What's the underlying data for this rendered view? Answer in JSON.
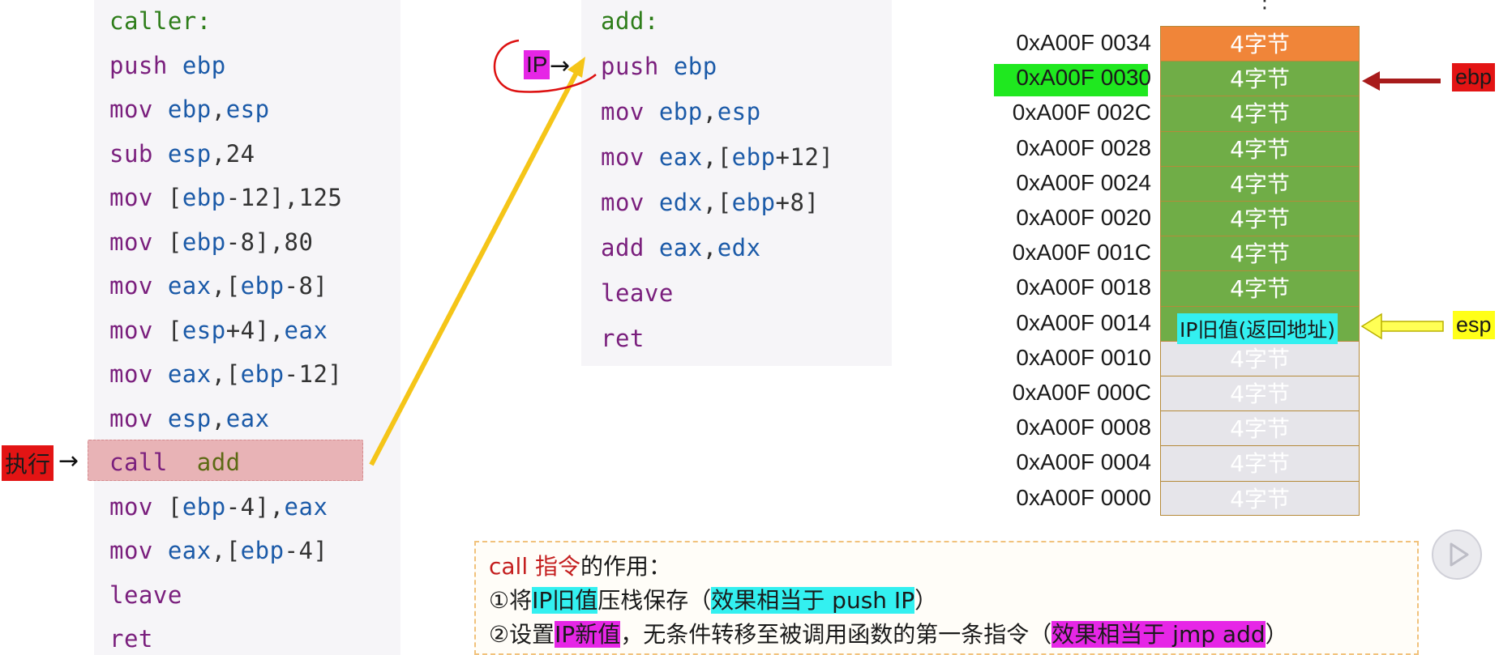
{
  "caller": {
    "lines": [
      [
        {
          "t": "caller:",
          "c": "lbl"
        }
      ],
      [
        {
          "t": "push ",
          "c": "op-purple"
        },
        {
          "t": "ebp",
          "c": "reg"
        }
      ],
      [
        {
          "t": "mov ",
          "c": "op-purple"
        },
        {
          "t": "ebp",
          "c": "reg"
        },
        {
          "t": ",",
          "c": "pun"
        },
        {
          "t": "esp",
          "c": "reg"
        }
      ],
      [
        {
          "t": "sub ",
          "c": "op-purple"
        },
        {
          "t": "esp",
          "c": "reg"
        },
        {
          "t": ",24",
          "c": "num"
        }
      ],
      [
        {
          "t": "mov ",
          "c": "op-purple"
        },
        {
          "t": "[",
          "c": "pun"
        },
        {
          "t": "ebp",
          "c": "reg"
        },
        {
          "t": "-12],125",
          "c": "num"
        }
      ],
      [
        {
          "t": "mov ",
          "c": "op-purple"
        },
        {
          "t": "[",
          "c": "pun"
        },
        {
          "t": "ebp",
          "c": "reg"
        },
        {
          "t": "-8],80",
          "c": "num"
        }
      ],
      [
        {
          "t": "mov ",
          "c": "op-purple"
        },
        {
          "t": "eax",
          "c": "reg"
        },
        {
          "t": ",[",
          "c": "pun"
        },
        {
          "t": "ebp",
          "c": "reg"
        },
        {
          "t": "-8]",
          "c": "num"
        }
      ],
      [
        {
          "t": "mov ",
          "c": "op-purple"
        },
        {
          "t": "[",
          "c": "pun"
        },
        {
          "t": "esp",
          "c": "reg"
        },
        {
          "t": "+4],",
          "c": "num"
        },
        {
          "t": "eax",
          "c": "reg"
        }
      ],
      [
        {
          "t": "mov ",
          "c": "op-purple"
        },
        {
          "t": "eax",
          "c": "reg"
        },
        {
          "t": ",[",
          "c": "pun"
        },
        {
          "t": "ebp",
          "c": "reg"
        },
        {
          "t": "-12]",
          "c": "num"
        }
      ],
      [
        {
          "t": "mov ",
          "c": "op-purple"
        },
        {
          "t": "esp",
          "c": "reg"
        },
        {
          "t": ",",
          "c": "pun"
        },
        {
          "t": "eax",
          "c": "reg"
        }
      ],
      [
        {
          "t": "call  ",
          "c": "op-purple"
        },
        {
          "t": "add",
          "c": "op-green"
        }
      ],
      [
        {
          "t": "mov ",
          "c": "op-purple"
        },
        {
          "t": "[",
          "c": "pun"
        },
        {
          "t": "ebp",
          "c": "reg"
        },
        {
          "t": "-4],",
          "c": "num"
        },
        {
          "t": "eax",
          "c": "reg"
        }
      ],
      [
        {
          "t": "mov ",
          "c": "op-purple"
        },
        {
          "t": "eax",
          "c": "reg"
        },
        {
          "t": ",[",
          "c": "pun"
        },
        {
          "t": "ebp",
          "c": "reg"
        },
        {
          "t": "-4]",
          "c": "num"
        }
      ],
      [
        {
          "t": "leave",
          "c": "op-purple"
        }
      ],
      [
        {
          "t": "ret",
          "c": "op-purple"
        }
      ]
    ]
  },
  "add": {
    "lines": [
      [
        {
          "t": "add:",
          "c": "lbl"
        }
      ],
      [
        {
          "t": "push ",
          "c": "op-purple"
        },
        {
          "t": "ebp",
          "c": "reg"
        }
      ],
      [
        {
          "t": "mov ",
          "c": "op-purple"
        },
        {
          "t": "ebp",
          "c": "reg"
        },
        {
          "t": ",",
          "c": "pun"
        },
        {
          "t": "esp",
          "c": "reg"
        }
      ],
      [
        {
          "t": "mov ",
          "c": "op-purple"
        },
        {
          "t": "eax",
          "c": "reg"
        },
        {
          "t": ",[",
          "c": "pun"
        },
        {
          "t": "ebp",
          "c": "reg"
        },
        {
          "t": "+12]",
          "c": "num"
        }
      ],
      [
        {
          "t": "mov ",
          "c": "op-purple"
        },
        {
          "t": "edx",
          "c": "reg"
        },
        {
          "t": ",[",
          "c": "pun"
        },
        {
          "t": "ebp",
          "c": "reg"
        },
        {
          "t": "+8]",
          "c": "num"
        }
      ],
      [
        {
          "t": "add ",
          "c": "op-purple"
        },
        {
          "t": "eax",
          "c": "reg"
        },
        {
          "t": ",",
          "c": "pun"
        },
        {
          "t": "edx",
          "c": "reg"
        }
      ],
      [
        {
          "t": "leave",
          "c": "op-purple"
        }
      ],
      [
        {
          "t": "ret",
          "c": "op-purple"
        }
      ]
    ]
  },
  "markers": {
    "exec_label": "执行",
    "ip_label": "IP",
    "arrow": "→",
    "ebp_label": "ebp",
    "esp_label": "esp",
    "top_dots": "⋮"
  },
  "stack": {
    "addresses": [
      "0xA00F 0034",
      "0xA00F 0030",
      "0xA00F 002C",
      "0xA00F 0028",
      "0xA00F 0024",
      "0xA00F 0020",
      "0xA00F 001C",
      "0xA00F 0018",
      "0xA00F 0014",
      "0xA00F 0010",
      "0xA00F 000C",
      "0xA00F 0008",
      "0xA00F 0004",
      "0xA00F 0000"
    ],
    "cell_label": "4字节",
    "cell_colors": [
      "orange",
      "green",
      "green",
      "green",
      "green",
      "green",
      "green",
      "green",
      "green",
      "grey",
      "grey",
      "grey",
      "grey",
      "grey"
    ],
    "esp_cell_label": "IP旧值(返回地址)",
    "colors": {
      "orange": "#f08539",
      "green": "#70ad47",
      "grey": "#e6e5ea",
      "address_highlight": "#1fe81f"
    }
  },
  "note": {
    "title_a": "call 指令",
    "title_b": "的作用：",
    "line1_a": "①将",
    "line1_hl": "IP旧值",
    "line1_b": "压栈保存（",
    "line1_hl2": "效果相当于 push IP",
    "line1_c": "）",
    "line2_a": "②设置",
    "line2_hl": "IP新值",
    "line2_b": "，无条件转移至被调用函数的第一条指令（",
    "line2_hl2": "效果相当于 jmp add",
    "line2_c": "）"
  }
}
